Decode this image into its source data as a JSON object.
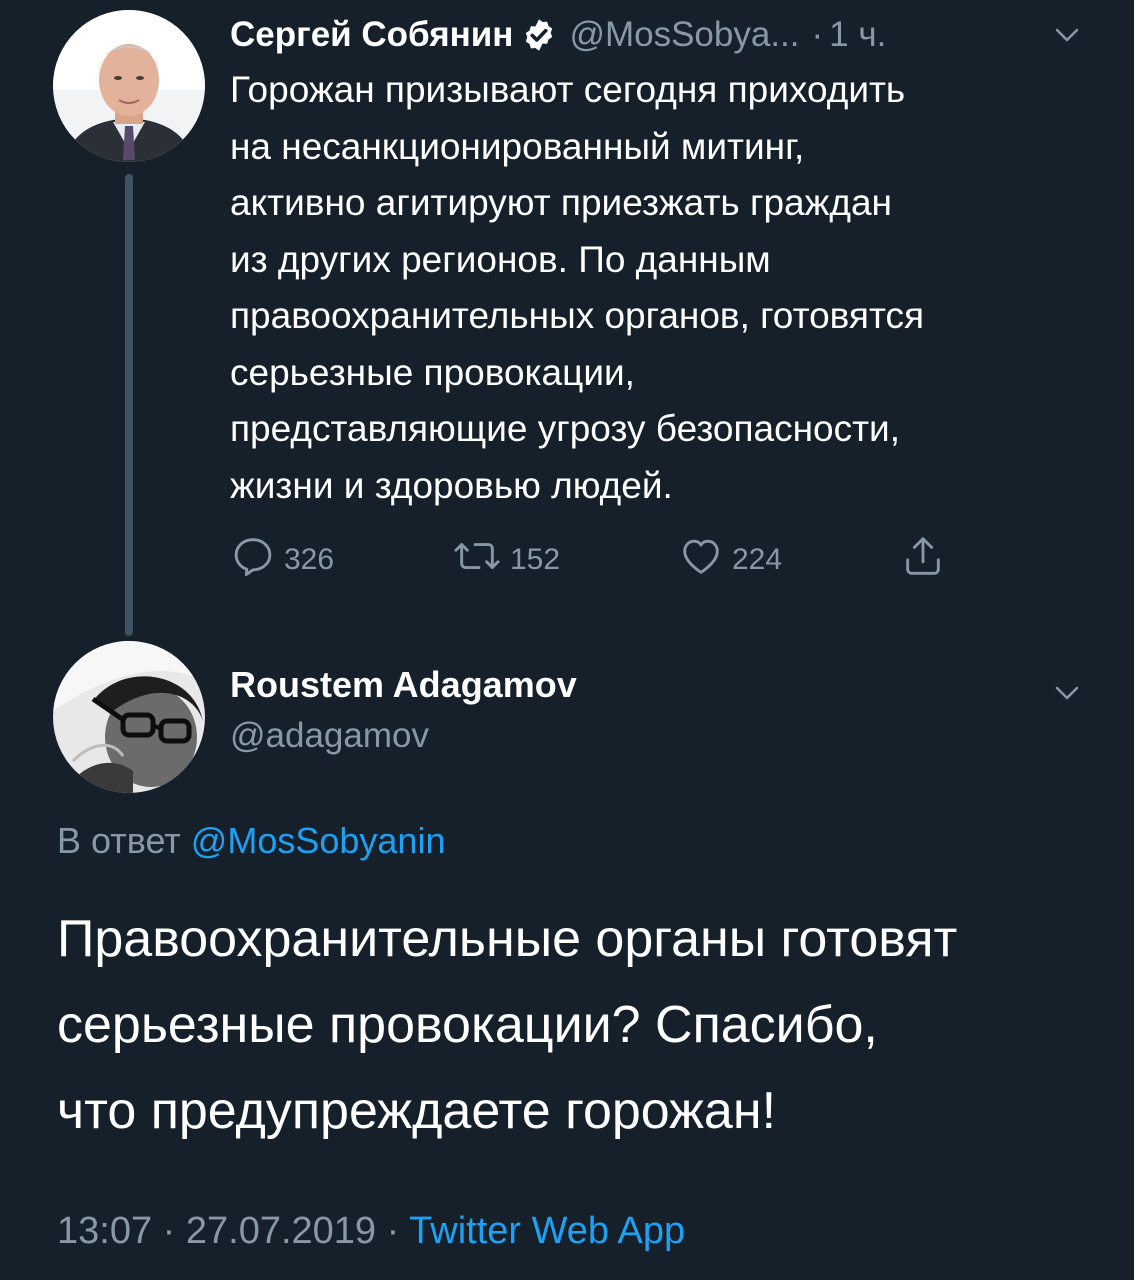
{
  "parent_tweet": {
    "author_name": "Сергей Собянин",
    "handle": "@MosSobya...",
    "separator": "·",
    "time": "1 ч.",
    "text": "Горожан призывают сегодня приходить\nна несанкционированный митинг,\nактивно агитируют приезжать граждан\nиз других регионов. По данным\nправоохранительных органов, готовятся\nсерьезные провокации,\nпредставляющие угрозу безопасности,\nжизни и здоровью людей.",
    "replies": "326",
    "retweets": "152",
    "likes": "224",
    "icons": [
      "verified-icon",
      "chevron-down-icon",
      "reply-icon",
      "retweet-icon",
      "like-icon",
      "share-icon"
    ]
  },
  "reply_tweet": {
    "author_name": "Roustem Adagamov",
    "handle": "@adagamov",
    "replying_prefix": "В ответ",
    "replying_to": "@MosSobyanin",
    "text": "Правоохранительные органы готовят\nсерьезные провокации? Спасибо,\nчто предупреждаете горожан!",
    "time": "13:07",
    "sep1": "·",
    "date": "27.07.2019",
    "sep2": "·",
    "source": "Twitter Web App"
  },
  "colors": {
    "background": "#15202b",
    "muted": "#8899a6",
    "link": "#1da1f2",
    "thread_line": "#3d5466"
  }
}
